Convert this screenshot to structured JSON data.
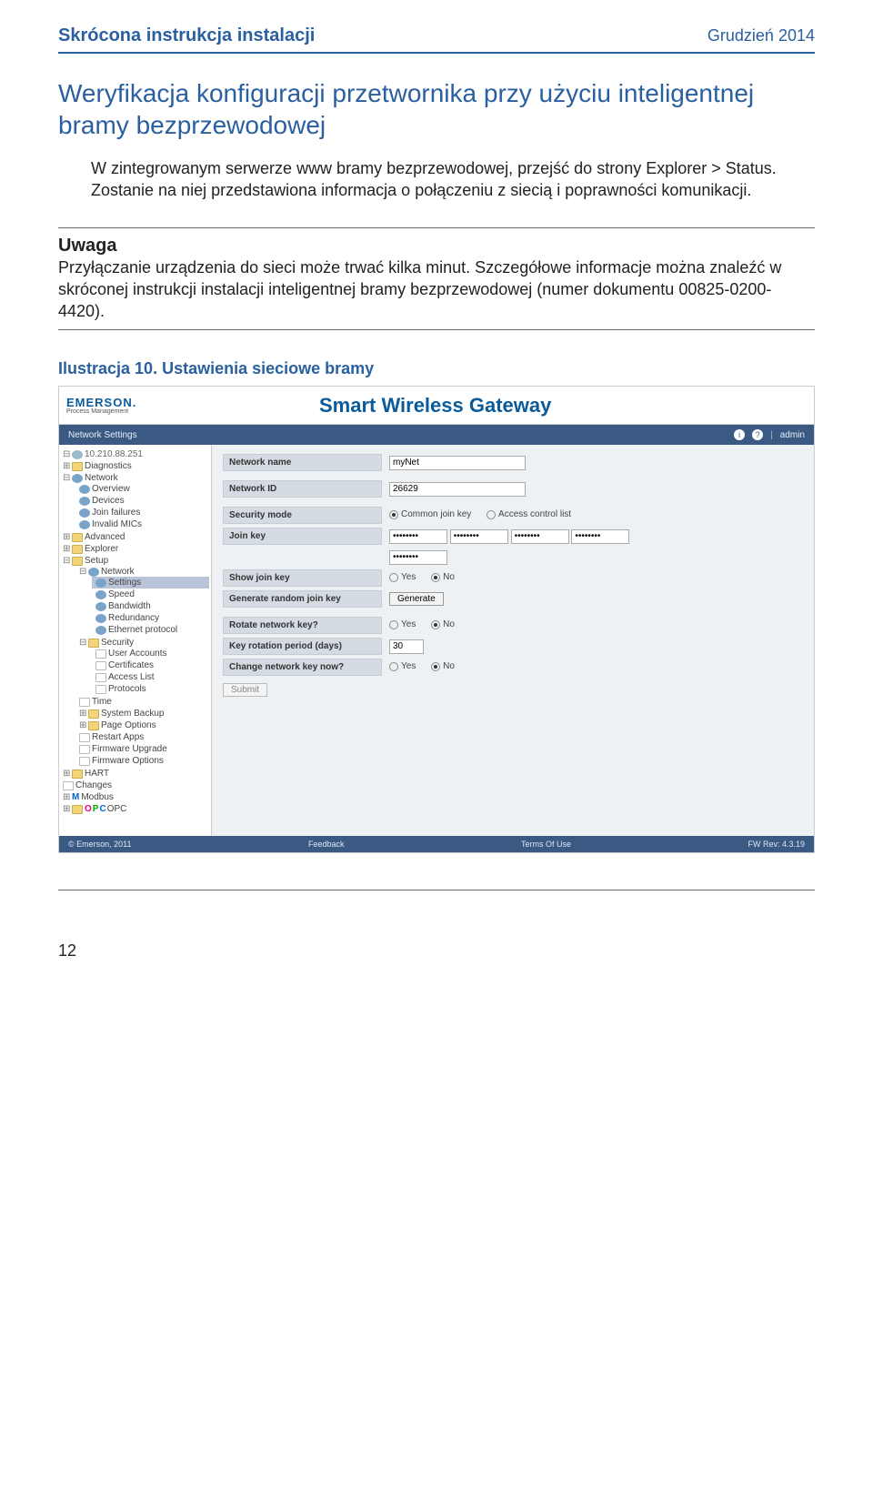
{
  "header": {
    "left": "Skrócona instrukcja instalacji",
    "right": "Grudzień 2014"
  },
  "heading": "Weryfikacja konfiguracji przetwornika przy użyciu inteligentnej bramy bezprzewodowej",
  "paragraph": "W zintegrowanym serwerze www bramy bezprzewodowej, przejść do strony Explorer > Status. Zostanie na niej przedstawiona informacja o połączeniu z siecią i poprawności komunikacji.",
  "note": {
    "title": "Uwaga",
    "body": "Przyłączanie urządzenia do sieci może trwać kilka minut. Szczegółowe informacje można znaleźć w skróconej instrukcji instalacji inteligentnej bramy bezprzewodowej (numer dokumentu 00825-0200-4420)."
  },
  "figure_caption": "Ilustracja 10.  Ustawienia sieciowe bramy",
  "gateway": {
    "logo_main": "EMERSON.",
    "logo_sub": "Process Management",
    "title": "Smart Wireless Gateway",
    "breadcrumb": "Network Settings",
    "user": "admin",
    "tree": {
      "ip": "10.210.88.251",
      "diagnostics": "Diagnostics",
      "network": "Network",
      "network_children": [
        "Overview",
        "Devices",
        "Join failures",
        "Invalid MICs"
      ],
      "advanced": "Advanced",
      "explorer": "Explorer",
      "setup": "Setup",
      "setup_network": "Network",
      "setup_network_children": [
        "Settings",
        "Speed",
        "Bandwidth",
        "Redundancy",
        "Ethernet protocol"
      ],
      "security": "Security",
      "security_children": [
        "User Accounts",
        "Certificates",
        "Access List",
        "Protocols"
      ],
      "time": "Time",
      "system_backup": "System Backup",
      "page_options": "Page Options",
      "restart_apps": "Restart Apps",
      "firmware_upgrade": "Firmware Upgrade",
      "firmware_options": "Firmware Options",
      "hart": "HART",
      "changes": "Changes",
      "modbus": "Modbus",
      "opc": "OPC"
    },
    "form": {
      "network_name": {
        "label": "Network name",
        "value": "myNet"
      },
      "network_id": {
        "label": "Network ID",
        "value": "26629"
      },
      "security_mode": {
        "label": "Security mode",
        "opt1": "Common join key",
        "opt2": "Access control list"
      },
      "join_key": {
        "label": "Join key"
      },
      "show_join_key": {
        "label": "Show join key",
        "yes": "Yes",
        "no": "No"
      },
      "generate": {
        "label": "Generate random join key",
        "button": "Generate"
      },
      "rotate": {
        "label": "Rotate network key?",
        "yes": "Yes",
        "no": "No"
      },
      "rotation_period": {
        "label": "Key rotation period (days)",
        "value": "30"
      },
      "change_now": {
        "label": "Change network key now?",
        "yes": "Yes",
        "no": "No"
      },
      "submit": "Submit"
    },
    "footer": {
      "left": "© Emerson, 2011",
      "center": "Feedback",
      "center2": "Terms Of Use",
      "right": "FW Rev: 4.3.19"
    }
  },
  "page_number": "12"
}
